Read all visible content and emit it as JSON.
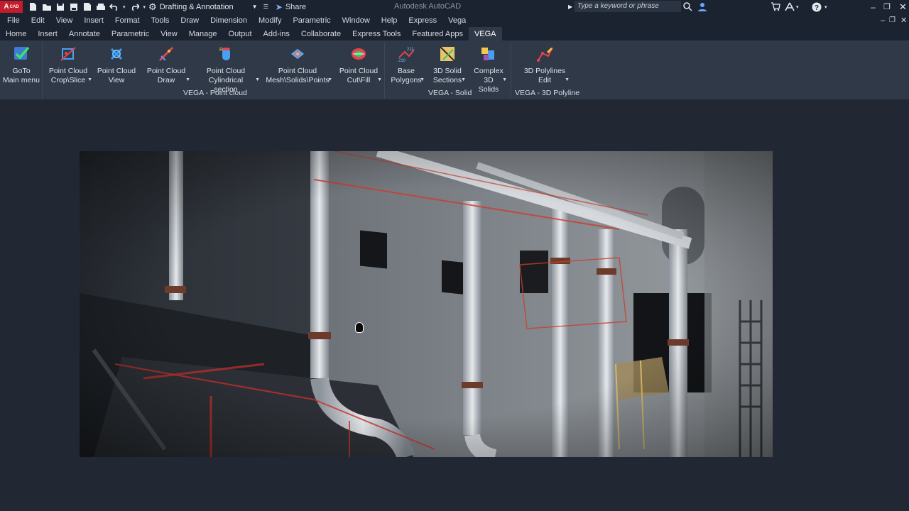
{
  "titlebar": {
    "app_badge": "A",
    "app_badge_small": "CAD",
    "workspace": "Drafting & Annotation",
    "share": "Share",
    "app_title": "Autodesk AutoCAD",
    "search_placeholder": "Type a keyword or phrase"
  },
  "menubar": [
    "File",
    "Edit",
    "View",
    "Insert",
    "Format",
    "Tools",
    "Draw",
    "Dimension",
    "Modify",
    "Parametric",
    "Window",
    "Help",
    "Express",
    "Vega"
  ],
  "tabs": [
    "Home",
    "Insert",
    "Annotate",
    "Parametric",
    "View",
    "Manage",
    "Output",
    "Add-ins",
    "Collaborate",
    "Express Tools",
    "Featured Apps",
    "VEGA"
  ],
  "active_tab": "VEGA",
  "ribbon": {
    "buttons": [
      {
        "l1": "GoTo",
        "l2": "Main menu",
        "icon": "goto-check-icon"
      },
      {
        "l1": "Point Cloud",
        "l2": "Crop\\Slice",
        "icon": "crop-slice-icon"
      },
      {
        "l1": "Point Cloud",
        "l2": "View",
        "icon": "pc-view-icon"
      },
      {
        "l1": "Point Cloud",
        "l2": "Draw",
        "icon": "pc-draw-icon"
      },
      {
        "l1": "Point Cloud",
        "l2": "Cylindrical section",
        "icon": "cylinder-section-icon"
      },
      {
        "l1": "Point Cloud",
        "l2": "Mesh\\Solids\\Points",
        "icon": "mesh-solids-icon"
      },
      {
        "l1": "Point Cloud",
        "l2": "Cut\\Fill",
        "icon": "cut-fill-icon"
      },
      {
        "l1": "Base",
        "l2": "Polygons",
        "icon": "base-polygons-icon"
      },
      {
        "l1": "3D Solid",
        "l2": "Sections",
        "icon": "solid-sections-icon"
      },
      {
        "l1": "Complex",
        "l2": "3D Solids",
        "icon": "complex-solids-icon"
      },
      {
        "l1": "3D Polylines",
        "l2": "Edit",
        "icon": "polyline-edit-icon"
      }
    ],
    "panels": [
      "VEGA - Point cloud",
      "VEGA - Solid",
      "VEGA - 3D Polyline"
    ]
  },
  "viewport": {
    "content": "point-cloud-scan"
  }
}
